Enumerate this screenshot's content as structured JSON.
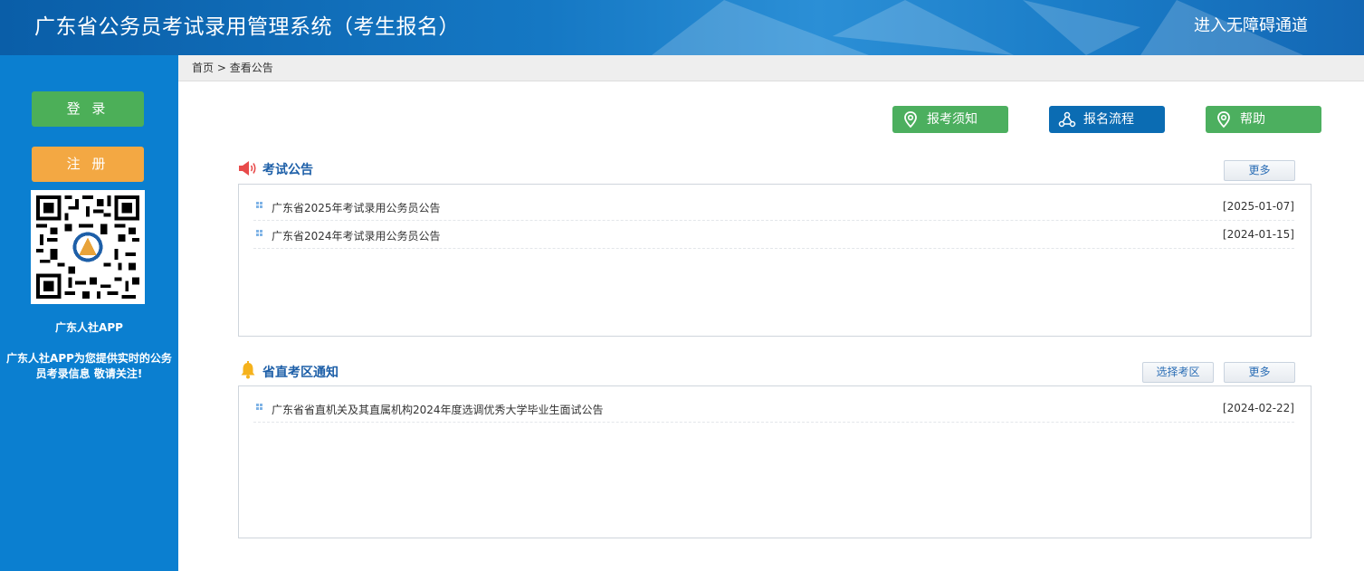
{
  "header": {
    "title": "广东省公务员考试录用管理系统（考生报名）",
    "accessibility_link": "进入无障碍通道"
  },
  "sidebar": {
    "login_label": "登 录",
    "register_label": "注 册",
    "app_name": "广东人社APP",
    "app_desc": "广东人社APP为您提供实时的公务员考录信息 敬请关注!"
  },
  "breadcrumb": {
    "home": "首页",
    "separator": ">",
    "current": "查看公告"
  },
  "actions": {
    "notice_label": "报考须知",
    "process_label": "报名流程",
    "help_label": "帮助"
  },
  "exam_announcements": {
    "title": "考试公告",
    "more_label": "更多",
    "items": [
      {
        "title": "广东省2025年考试录用公务员公告",
        "date": "[2025-01-07]"
      },
      {
        "title": "广东省2024年考试录用公务员公告",
        "date": "[2024-01-15]"
      }
    ]
  },
  "region_notices": {
    "title": "省直考区通知",
    "select_region_label": "选择考区",
    "more_label": "更多",
    "items": [
      {
        "title": "广东省省直机关及其直属机构2024年度选调优秀大学毕业生面试公告",
        "date": "[2024-02-22]"
      }
    ]
  },
  "colors": {
    "header_blue": "#1578c4",
    "sidebar_blue": "#0b7fd0",
    "login_green": "#4caf58",
    "register_orange": "#f3a843",
    "action_green": "#4caf5f",
    "action_blue": "#0b6cb3",
    "section_title_blue": "#1d5fa8"
  },
  "icons": {
    "notice": "location-pin-icon",
    "process": "flow-triangle-icon",
    "help": "location-pin-icon",
    "exam_section": "megaphone-icon",
    "region_section": "bell-icon"
  }
}
